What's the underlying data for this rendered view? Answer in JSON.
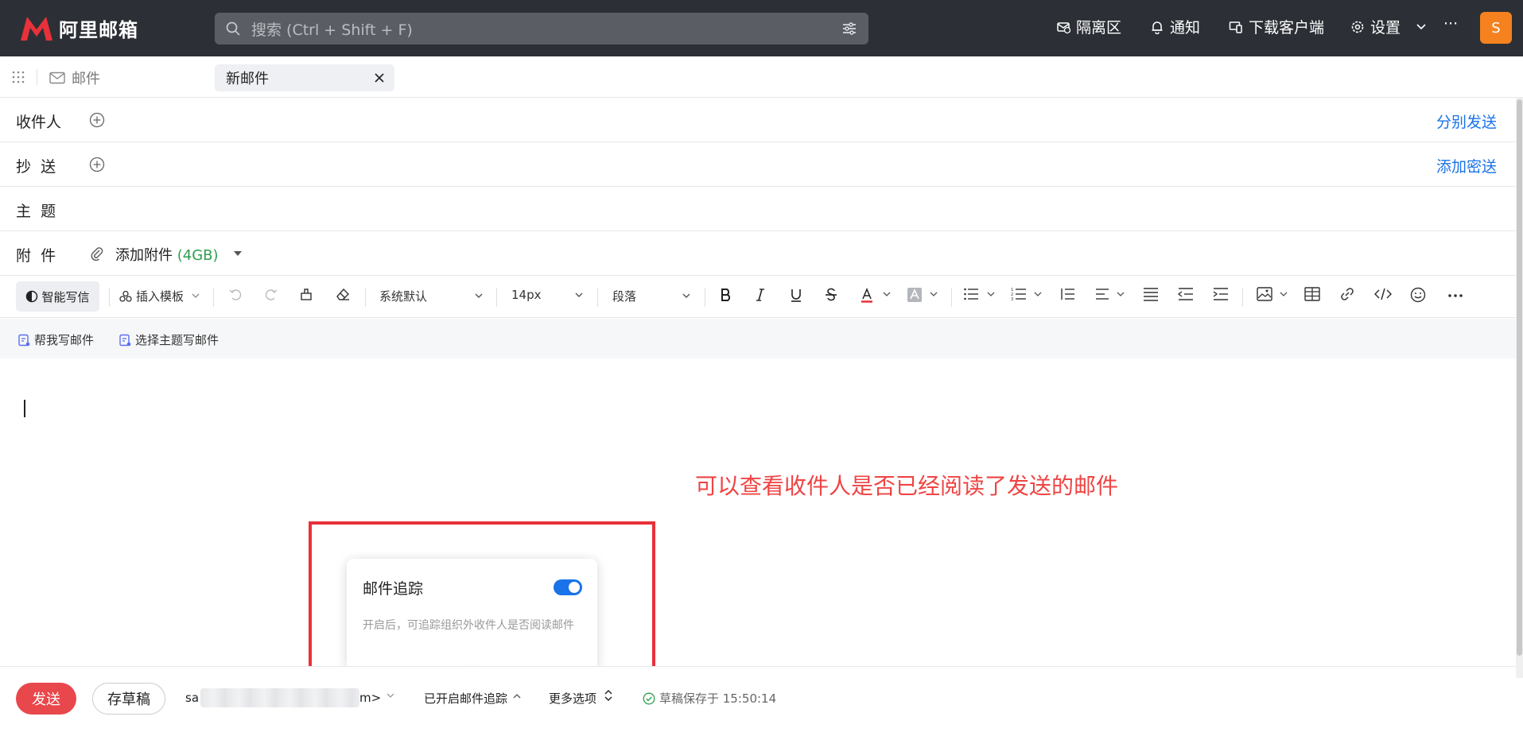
{
  "app": {
    "name": "阿里邮箱",
    "search_placeholder": "搜索 (Ctrl + Shift + F)",
    "nav": {
      "quarantine": "隔离区",
      "notifications": "通知",
      "download_client": "下载客户端",
      "settings": "设置",
      "more": "···"
    },
    "avatar_letter": "S"
  },
  "tabs": {
    "mail": "邮件",
    "new_mail": "新邮件"
  },
  "compose": {
    "to_label": "收件人",
    "split_send": "分别发送",
    "cc_label": "抄  送",
    "add_bcc": "添加密送",
    "subject_label": "主  题",
    "attach_label": "附  件",
    "add_attachment": "添加附件",
    "attachment_limit": "(4GB)"
  },
  "toolbar": {
    "ai_write": "智能写信",
    "insert_template": "插入模板",
    "font_family": "系统默认",
    "font_size": "14px",
    "paragraph": "段落"
  },
  "ai_actions": {
    "help_write": "帮我写邮件",
    "topic_write": "选择主题写邮件"
  },
  "annotation": "可以查看收件人是否已经阅读了发送的邮件",
  "tracking_popup": {
    "title": "邮件追踪",
    "enabled": true,
    "description": "开启后，可追踪组织外收件人是否阅读邮件"
  },
  "bottom": {
    "send": "发送",
    "save_draft": "存草稿",
    "sender_prefix": "sa",
    "sender_suffix": "m>",
    "tracking_status": "已开启邮件追踪",
    "more_options": "更多选项",
    "draft_saved": "草稿保存于 15:50:14"
  },
  "colors": {
    "topbar": "#2c3036",
    "accent": "#1a73e8",
    "send": "#e8474c",
    "annotation": "#ef4444",
    "avatar": "#f5821f"
  }
}
